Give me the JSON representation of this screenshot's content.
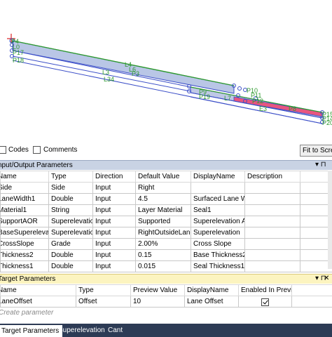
{
  "preview": {
    "point_labels": {
      "p_top": [
        "P4",
        "P1",
        "L0",
        "P17",
        "P18"
      ],
      "l_top": [
        "L4",
        "L6",
        "P3"
      ],
      "l_mid": [
        "L3",
        "L34"
      ],
      "right_cluster_a": [
        "P9",
        "P10",
        "P19"
      ],
      "right_cluster_b": [
        "P11",
        "P12",
        "P13"
      ],
      "right_cluster_c": [
        "L7"
      ],
      "far_right": [
        "P15",
        "P14",
        "P16",
        "P20"
      ],
      "e_label": "E3",
      "p8": "P8"
    }
  },
  "options": {
    "codes_label": "Codes",
    "comments_label": "Comments",
    "fit_button": "Fit to Scre"
  },
  "io_panel": {
    "title": "nput/Output Parameters",
    "pin": "▾ ⊓",
    "close": "",
    "columns": [
      "Name",
      "Type",
      "Direction",
      "Default Value",
      "DisplayName",
      "Description"
    ],
    "rows": [
      [
        "Side",
        "Side",
        "Input",
        "Right",
        "",
        ""
      ],
      [
        "LaneWidth1",
        "Double",
        "Input",
        "4.5",
        "Surfaced Lane Wic",
        ""
      ],
      [
        "Material1",
        "String",
        "Input",
        "Layer Material",
        "Seal1",
        ""
      ],
      [
        "SupportAOR",
        "Superelevation",
        "Input",
        "Supported",
        "Superelevation Ax",
        ""
      ],
      [
        "BaseSuperelevation",
        "Superelevation",
        "Input",
        "RightOutsideLane",
        "Superelevation",
        ""
      ],
      [
        "CrossSlope",
        "Grade",
        "Input",
        "2.00%",
        "Cross Slope",
        ""
      ],
      [
        "Thickness2",
        "Double",
        "Input",
        "0.15",
        "Base Thickness2",
        ""
      ],
      [
        "Thickness1",
        "Double",
        "Input",
        "0.015",
        "Seal Thickness1",
        ""
      ]
    ]
  },
  "target_panel": {
    "title": "Target Parameters",
    "pin": "▾ ⊓",
    "close": "✕",
    "columns": [
      "Name",
      "Type",
      "Preview Value",
      "DisplayName",
      "Enabled In Previe"
    ],
    "rows": [
      [
        "LaneOffset",
        "Offset",
        "10",
        "Lane Offset",
        true
      ]
    ],
    "create_placeholder": "Create parameter"
  },
  "tabs": [
    {
      "label": "Target Parameters",
      "active": true
    },
    {
      "label": "Superelevation",
      "active": false
    },
    {
      "label": "Cant",
      "active": false
    }
  ]
}
